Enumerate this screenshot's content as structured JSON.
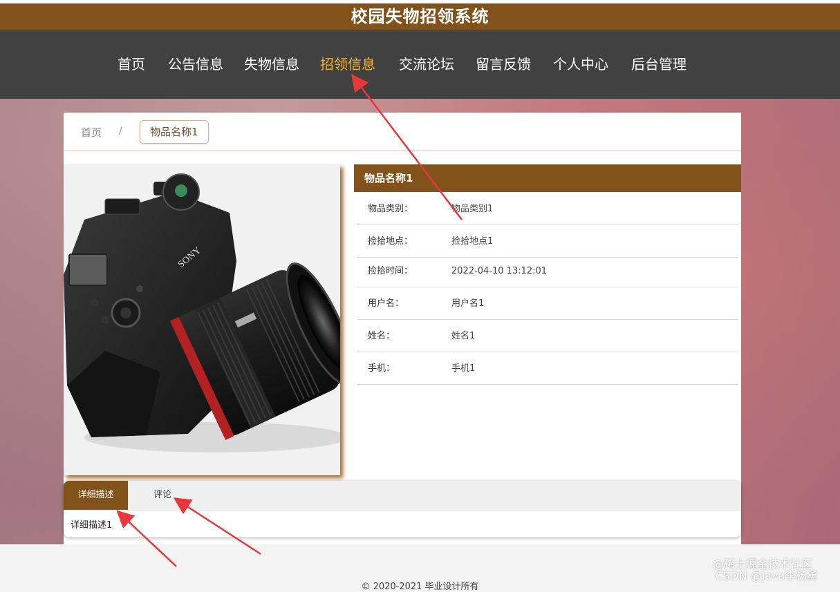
{
  "site_title": "校园失物招领系统",
  "nav": {
    "items": [
      {
        "label": "首页"
      },
      {
        "label": "公告信息"
      },
      {
        "label": "失物信息"
      },
      {
        "label": "招领信息"
      },
      {
        "label": "交流论坛"
      },
      {
        "label": "留言反馈"
      },
      {
        "label": "个人中心"
      },
      {
        "label": "后台管理"
      }
    ],
    "active_index": 3
  },
  "breadcrumb": {
    "home": "首页",
    "separator": "/",
    "current": "物品名称1"
  },
  "item": {
    "name": "物品名称1",
    "fields": [
      {
        "label": "物品类别：",
        "value": "物品类别1"
      },
      {
        "label": "捡拾地点：",
        "value": "捡拾地点1"
      },
      {
        "label": "捡拾时间：",
        "value": "2022-04-10 13:12:01"
      },
      {
        "label": "用户名：",
        "value": "用户名1"
      },
      {
        "label": "姓名：",
        "value": "姓名1"
      },
      {
        "label": "手机：",
        "value": "手机1"
      }
    ]
  },
  "tabs": [
    {
      "label": "详细描述"
    },
    {
      "label": "评论"
    }
  ],
  "tab_content": "详细描述1",
  "footer": "© 2020-2021 毕业设计所有",
  "watermark": {
    "line1": "@稀土掘金技术社区",
    "line2": "CSDN @java李杨勇"
  },
  "colors": {
    "brand": "#82521b",
    "nav_bg": "#414141",
    "active_nav": "#f3b52f",
    "annotation_arrow": "#e8373a"
  }
}
